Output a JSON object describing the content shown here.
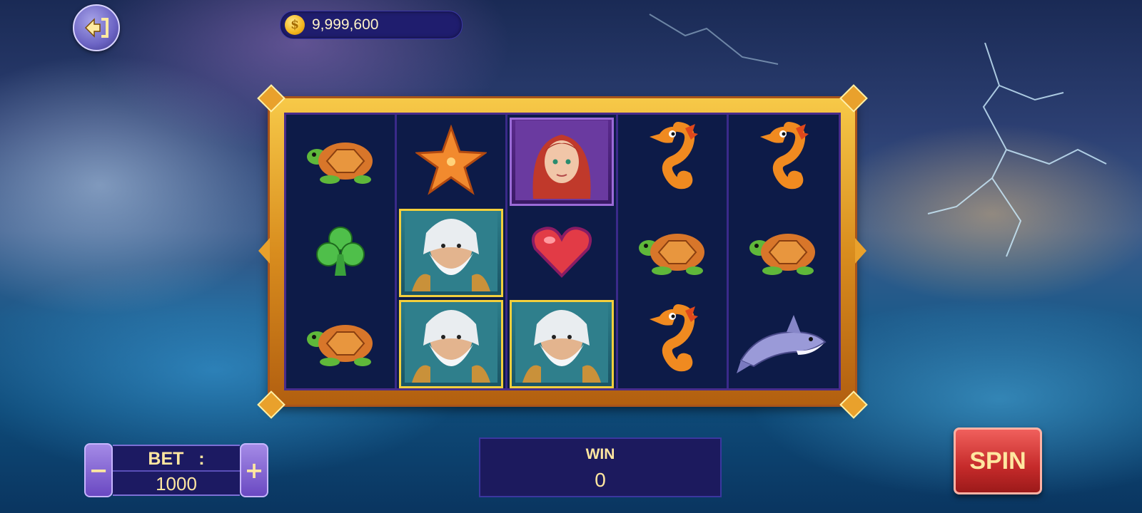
{
  "balance": {
    "coin_symbol": "$",
    "amount": "9,999,600"
  },
  "reels": [
    [
      {
        "symbol": "turtle",
        "icon": "turtle-icon",
        "highlight": "none"
      },
      {
        "symbol": "club",
        "icon": "club-icon",
        "highlight": "none"
      },
      {
        "symbol": "turtle",
        "icon": "turtle-icon",
        "highlight": "none"
      }
    ],
    [
      {
        "symbol": "starfish",
        "icon": "starfish-icon",
        "highlight": "none"
      },
      {
        "symbol": "poseidon",
        "icon": "poseidon-icon",
        "highlight": "win"
      },
      {
        "symbol": "poseidon",
        "icon": "poseidon-icon",
        "highlight": "win"
      }
    ],
    [
      {
        "symbol": "mermaid",
        "icon": "mermaid-icon",
        "highlight": "purple"
      },
      {
        "symbol": "heart",
        "icon": "heart-icon",
        "highlight": "none"
      },
      {
        "symbol": "poseidon",
        "icon": "poseidon-icon",
        "highlight": "win"
      }
    ],
    [
      {
        "symbol": "seahorse",
        "icon": "seahorse-icon",
        "highlight": "none"
      },
      {
        "symbol": "turtle",
        "icon": "turtle-icon",
        "highlight": "none"
      },
      {
        "symbol": "seahorse",
        "icon": "seahorse-icon",
        "highlight": "none"
      }
    ],
    [
      {
        "symbol": "seahorse",
        "icon": "seahorse-icon",
        "highlight": "none"
      },
      {
        "symbol": "turtle",
        "icon": "turtle-icon",
        "highlight": "none"
      },
      {
        "symbol": "shark",
        "icon": "shark-icon",
        "highlight": "none"
      }
    ]
  ],
  "bet": {
    "label": "BET   :",
    "value": "1000",
    "minus": "−",
    "plus": "+"
  },
  "win": {
    "label": "WIN",
    "value": "0"
  },
  "spin": {
    "label": "SPIN"
  },
  "colors": {
    "frame_gold": "#f7c948",
    "reel_bg": "#0d1b48",
    "win_border": "#f3cf3c",
    "spin_red": "#c52a2a",
    "text_gold": "#ffe7a0"
  }
}
